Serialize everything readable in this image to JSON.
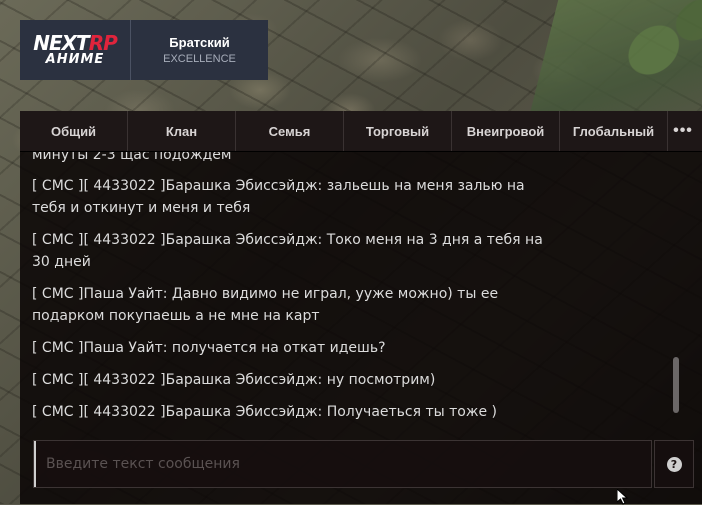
{
  "logo": {
    "part1": "NEXT",
    "part2": "RP",
    "sub": "АНИМЕ"
  },
  "server": {
    "name": "Братский",
    "subtitle": "EXCELLENCE"
  },
  "tabs": [
    {
      "label": "Общий"
    },
    {
      "label": "Клан"
    },
    {
      "label": "Семья"
    },
    {
      "label": "Торговый"
    },
    {
      "label": "Внеигровой"
    },
    {
      "label": "Глобальный"
    },
    {
      "label": "•••"
    }
  ],
  "messages": [
    {
      "text": "минуты 2-3 щас подождем"
    },
    {
      "text": "[ СМС ][ 4433022 ]Барашка Эбиссэйдж: зальешь на меня залью на тебя и откинут и меня и тебя"
    },
    {
      "text": "[ СМС ][ 4433022 ]Барашка Эбиссэйдж: Токо меня на 3 дня а тебя на 30 дней"
    },
    {
      "text": "[ СМС ]Паша Уайт: Давно видимо не играл, ууже можно) ты ее подарком покупаешь а не мне на карт"
    },
    {
      "text": "[ СМС ]Паша Уайт: получается на откат идешь?"
    },
    {
      "text": "[ СМС ][ 4433022 ]Барашка Эбиссэйдж: ну посмотрим)"
    },
    {
      "text": "[ СМС ][ 4433022 ]Барашка Эбиссэйдж: Получаеться ты тоже )"
    }
  ],
  "input": {
    "placeholder": "Введите текст сообщения",
    "value": ""
  },
  "help_button": {
    "label": "?"
  },
  "colors": {
    "logo_red": "#e0243c",
    "badge_bg": "#2b3140",
    "chat_bg": "#0a0505"
  }
}
